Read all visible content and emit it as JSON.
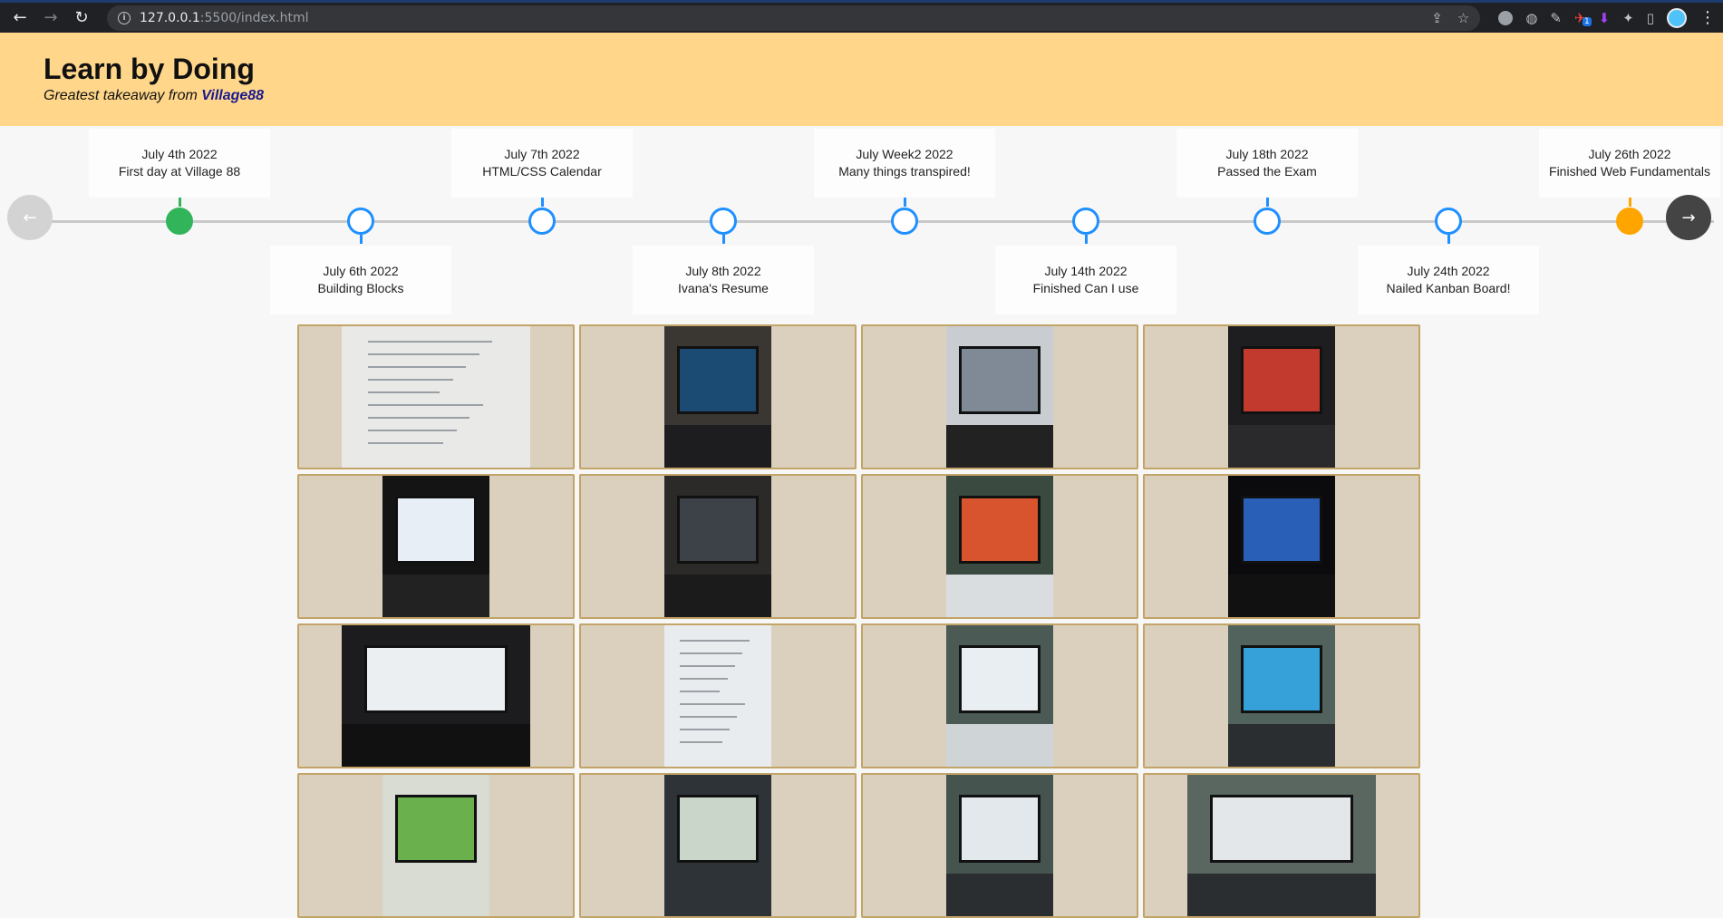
{
  "browser": {
    "url_host": "127.0.0.1",
    "url_rest": ":5500/index.html",
    "extension_badge": "1"
  },
  "header": {
    "title": "Learn by Doing",
    "subtitle_prefix": "Greatest takeaway from ",
    "subtitle_link": "Village88"
  },
  "timeline": {
    "prev_label": "←",
    "next_label": "→",
    "events": [
      {
        "date": "July 4th 2022",
        "title": "First day at Village 88",
        "status": "complete"
      },
      {
        "date": "July 6th 2022",
        "title": "Building Blocks",
        "status": "pending"
      },
      {
        "date": "July 7th 2022",
        "title": "HTML/CSS Calendar",
        "status": "pending"
      },
      {
        "date": "July 8th 2022",
        "title": "Ivana's Resume",
        "status": "pending"
      },
      {
        "date": "July Week2 2022",
        "title": "Many things transpired!",
        "status": "pending"
      },
      {
        "date": "July 14th 2022",
        "title": "Finished Can I use",
        "status": "pending"
      },
      {
        "date": "July 18th 2022",
        "title": "Passed the Exam",
        "status": "pending"
      },
      {
        "date": "July 24th 2022",
        "title": "Nailed Kanban Board!",
        "status": "pending"
      },
      {
        "date": "July 26th 2022",
        "title": "Finished Web Fundamentals",
        "status": "current"
      }
    ]
  },
  "colors": {
    "header_bg": "#ffd68a",
    "timeline_pending": "#1e90ff",
    "timeline_complete": "#32b45a",
    "timeline_current": "#ffa500",
    "cell_bg": "#dbd0bd",
    "cell_border": "#c2a468"
  },
  "gallery": {
    "photos": [
      {
        "subject": "handwritten-sketch-notebook"
      },
      {
        "subject": "laptop-video-call"
      },
      {
        "subject": "laptop-webcam-selfie"
      },
      {
        "subject": "laptop-red-layout"
      },
      {
        "subject": "laptop-calendar-page"
      },
      {
        "subject": "laptop-zoom-grid"
      },
      {
        "subject": "desk-monitor-code"
      },
      {
        "subject": "laptop-blue-site"
      },
      {
        "subject": "monitor-document-edit"
      },
      {
        "subject": "printed-resume-ivana-funcion"
      },
      {
        "subject": "desk-monitor-laptop"
      },
      {
        "subject": "monitor-colorful-site"
      },
      {
        "subject": "screen-green-table"
      },
      {
        "subject": "monitor-kanban-columns"
      },
      {
        "subject": "desk-monitor-dashboard"
      },
      {
        "subject": "desk-dual-screen"
      }
    ]
  }
}
